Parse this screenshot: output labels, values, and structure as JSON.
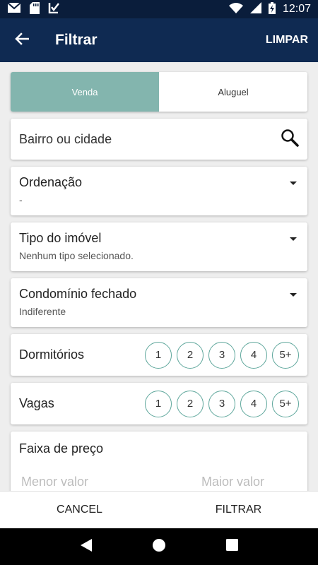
{
  "status": {
    "time": "12:07",
    "left_icons": [
      "gmail-icon",
      "sd-card-icon",
      "download-check-icon"
    ],
    "right_icons": [
      "wifi-icon",
      "signal-icon",
      "battery-charging-icon"
    ]
  },
  "app_bar": {
    "title": "Filtrar",
    "clear_label": "LIMPAR",
    "background": "#0f2a52"
  },
  "segment": {
    "options": [
      "Venda",
      "Aluguel"
    ],
    "selected": "Venda",
    "active_color": "#83b5ae"
  },
  "search": {
    "placeholder": "Bairro ou cidade"
  },
  "ordenacao": {
    "title": "Ordenação",
    "value": "-"
  },
  "tipo_imovel": {
    "title": "Tipo do imóvel",
    "value": "Nenhum tipo selecionado."
  },
  "condominio": {
    "title": "Condomínio fechado",
    "value": "Indiferente"
  },
  "dormitorios": {
    "title": "Dormitórios",
    "options": [
      "1",
      "2",
      "3",
      "4",
      "5+"
    ]
  },
  "vagas": {
    "title": "Vagas",
    "options": [
      "1",
      "2",
      "3",
      "4",
      "5+"
    ]
  },
  "faixa_preco": {
    "title": "Faixa de preço",
    "min_placeholder": "Menor valor",
    "max_placeholder": "Maior valor"
  },
  "bottom_actions": {
    "cancel_label": "CANCEL",
    "filter_label": "FILTRAR"
  },
  "accent_color": "#5fa79c"
}
